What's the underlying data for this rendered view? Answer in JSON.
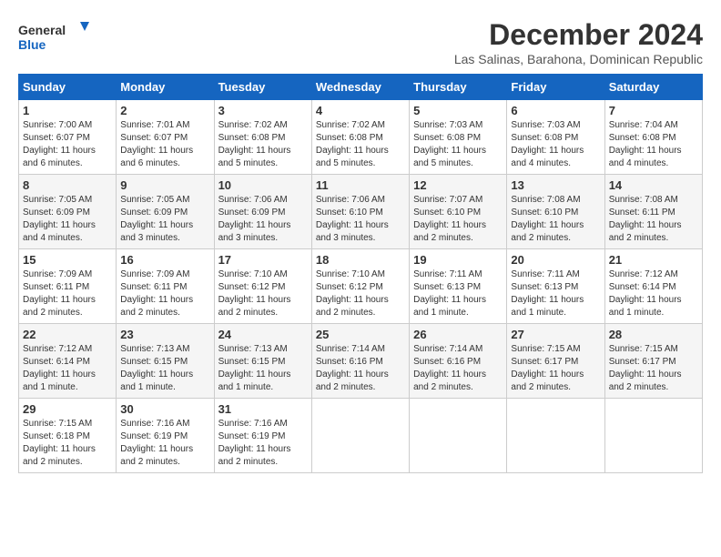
{
  "logo": {
    "text_general": "General",
    "text_blue": "Blue"
  },
  "header": {
    "title": "December 2024",
    "subtitle": "Las Salinas, Barahona, Dominican Republic"
  },
  "weekdays": [
    "Sunday",
    "Monday",
    "Tuesday",
    "Wednesday",
    "Thursday",
    "Friday",
    "Saturday"
  ],
  "weeks": [
    [
      {
        "day": "1",
        "sunrise": "Sunrise: 7:00 AM",
        "sunset": "Sunset: 6:07 PM",
        "daylight": "Daylight: 11 hours and 6 minutes."
      },
      {
        "day": "2",
        "sunrise": "Sunrise: 7:01 AM",
        "sunset": "Sunset: 6:07 PM",
        "daylight": "Daylight: 11 hours and 6 minutes."
      },
      {
        "day": "3",
        "sunrise": "Sunrise: 7:02 AM",
        "sunset": "Sunset: 6:08 PM",
        "daylight": "Daylight: 11 hours and 5 minutes."
      },
      {
        "day": "4",
        "sunrise": "Sunrise: 7:02 AM",
        "sunset": "Sunset: 6:08 PM",
        "daylight": "Daylight: 11 hours and 5 minutes."
      },
      {
        "day": "5",
        "sunrise": "Sunrise: 7:03 AM",
        "sunset": "Sunset: 6:08 PM",
        "daylight": "Daylight: 11 hours and 5 minutes."
      },
      {
        "day": "6",
        "sunrise": "Sunrise: 7:03 AM",
        "sunset": "Sunset: 6:08 PM",
        "daylight": "Daylight: 11 hours and 4 minutes."
      },
      {
        "day": "7",
        "sunrise": "Sunrise: 7:04 AM",
        "sunset": "Sunset: 6:08 PM",
        "daylight": "Daylight: 11 hours and 4 minutes."
      }
    ],
    [
      {
        "day": "8",
        "sunrise": "Sunrise: 7:05 AM",
        "sunset": "Sunset: 6:09 PM",
        "daylight": "Daylight: 11 hours and 4 minutes."
      },
      {
        "day": "9",
        "sunrise": "Sunrise: 7:05 AM",
        "sunset": "Sunset: 6:09 PM",
        "daylight": "Daylight: 11 hours and 3 minutes."
      },
      {
        "day": "10",
        "sunrise": "Sunrise: 7:06 AM",
        "sunset": "Sunset: 6:09 PM",
        "daylight": "Daylight: 11 hours and 3 minutes."
      },
      {
        "day": "11",
        "sunrise": "Sunrise: 7:06 AM",
        "sunset": "Sunset: 6:10 PM",
        "daylight": "Daylight: 11 hours and 3 minutes."
      },
      {
        "day": "12",
        "sunrise": "Sunrise: 7:07 AM",
        "sunset": "Sunset: 6:10 PM",
        "daylight": "Daylight: 11 hours and 2 minutes."
      },
      {
        "day": "13",
        "sunrise": "Sunrise: 7:08 AM",
        "sunset": "Sunset: 6:10 PM",
        "daylight": "Daylight: 11 hours and 2 minutes."
      },
      {
        "day": "14",
        "sunrise": "Sunrise: 7:08 AM",
        "sunset": "Sunset: 6:11 PM",
        "daylight": "Daylight: 11 hours and 2 minutes."
      }
    ],
    [
      {
        "day": "15",
        "sunrise": "Sunrise: 7:09 AM",
        "sunset": "Sunset: 6:11 PM",
        "daylight": "Daylight: 11 hours and 2 minutes."
      },
      {
        "day": "16",
        "sunrise": "Sunrise: 7:09 AM",
        "sunset": "Sunset: 6:11 PM",
        "daylight": "Daylight: 11 hours and 2 minutes."
      },
      {
        "day": "17",
        "sunrise": "Sunrise: 7:10 AM",
        "sunset": "Sunset: 6:12 PM",
        "daylight": "Daylight: 11 hours and 2 minutes."
      },
      {
        "day": "18",
        "sunrise": "Sunrise: 7:10 AM",
        "sunset": "Sunset: 6:12 PM",
        "daylight": "Daylight: 11 hours and 2 minutes."
      },
      {
        "day": "19",
        "sunrise": "Sunrise: 7:11 AM",
        "sunset": "Sunset: 6:13 PM",
        "daylight": "Daylight: 11 hours and 1 minute."
      },
      {
        "day": "20",
        "sunrise": "Sunrise: 7:11 AM",
        "sunset": "Sunset: 6:13 PM",
        "daylight": "Daylight: 11 hours and 1 minute."
      },
      {
        "day": "21",
        "sunrise": "Sunrise: 7:12 AM",
        "sunset": "Sunset: 6:14 PM",
        "daylight": "Daylight: 11 hours and 1 minute."
      }
    ],
    [
      {
        "day": "22",
        "sunrise": "Sunrise: 7:12 AM",
        "sunset": "Sunset: 6:14 PM",
        "daylight": "Daylight: 11 hours and 1 minute."
      },
      {
        "day": "23",
        "sunrise": "Sunrise: 7:13 AM",
        "sunset": "Sunset: 6:15 PM",
        "daylight": "Daylight: 11 hours and 1 minute."
      },
      {
        "day": "24",
        "sunrise": "Sunrise: 7:13 AM",
        "sunset": "Sunset: 6:15 PM",
        "daylight": "Daylight: 11 hours and 1 minute."
      },
      {
        "day": "25",
        "sunrise": "Sunrise: 7:14 AM",
        "sunset": "Sunset: 6:16 PM",
        "daylight": "Daylight: 11 hours and 2 minutes."
      },
      {
        "day": "26",
        "sunrise": "Sunrise: 7:14 AM",
        "sunset": "Sunset: 6:16 PM",
        "daylight": "Daylight: 11 hours and 2 minutes."
      },
      {
        "day": "27",
        "sunrise": "Sunrise: 7:15 AM",
        "sunset": "Sunset: 6:17 PM",
        "daylight": "Daylight: 11 hours and 2 minutes."
      },
      {
        "day": "28",
        "sunrise": "Sunrise: 7:15 AM",
        "sunset": "Sunset: 6:17 PM",
        "daylight": "Daylight: 11 hours and 2 minutes."
      }
    ],
    [
      {
        "day": "29",
        "sunrise": "Sunrise: 7:15 AM",
        "sunset": "Sunset: 6:18 PM",
        "daylight": "Daylight: 11 hours and 2 minutes."
      },
      {
        "day": "30",
        "sunrise": "Sunrise: 7:16 AM",
        "sunset": "Sunset: 6:19 PM",
        "daylight": "Daylight: 11 hours and 2 minutes."
      },
      {
        "day": "31",
        "sunrise": "Sunrise: 7:16 AM",
        "sunset": "Sunset: 6:19 PM",
        "daylight": "Daylight: 11 hours and 2 minutes."
      },
      null,
      null,
      null,
      null
    ]
  ]
}
